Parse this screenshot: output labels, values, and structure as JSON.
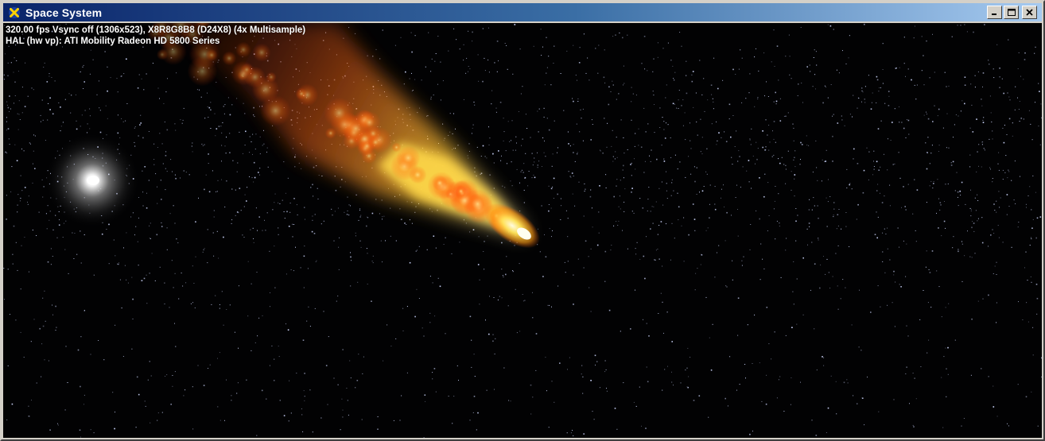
{
  "window": {
    "title": "Space System",
    "icon": "directx-x-icon",
    "controls": {
      "minimize": "minimize-icon",
      "maximize": "maximize-icon",
      "close": "close-icon"
    }
  },
  "overlay": {
    "line1": "320.00 fps Vsync off (1306x523), X8R8G8B8 (D24X8) (4x Multisample)",
    "line2": "HAL (hw vp): ATI Mobility Radeon HD 5800 Series"
  },
  "scene": {
    "background": "#020203",
    "star_color": "#cfd8ff",
    "sun_color": "#ffffff",
    "comet_core": "#fff6b0",
    "comet_mid": "#ffae1a",
    "comet_tail": "#e0401a"
  }
}
